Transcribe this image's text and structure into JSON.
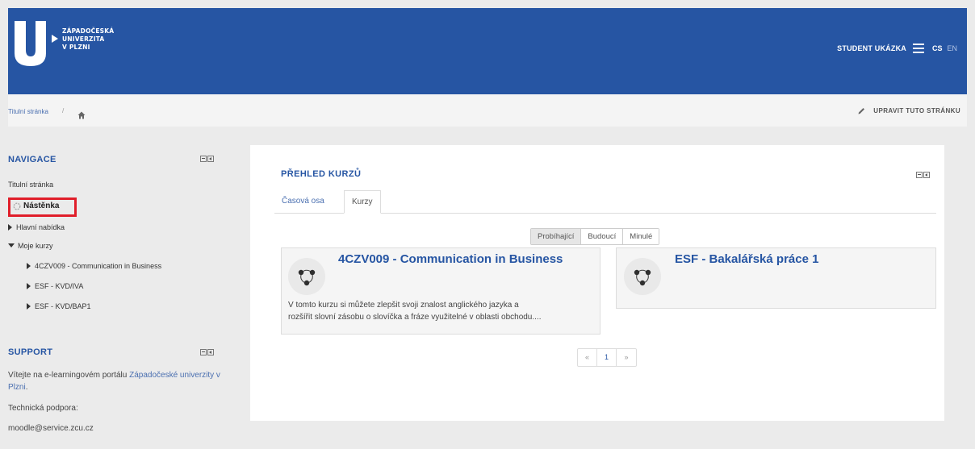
{
  "header": {
    "logo_lines": [
      "ZÁPADOČESKÁ",
      "UNIVERZITA",
      "V PLZNI"
    ],
    "user_name": "STUDENT UKÁZKA",
    "lang_active": "CS",
    "lang_other": "EN",
    "bg_color": "#2655a3"
  },
  "breadcrumb": {
    "home_link": "Titulní stránka",
    "separator": "/",
    "edit_page": "UPRAVIT TUTO STRÁNKU"
  },
  "navigation": {
    "title": "NAVIGACE",
    "items": {
      "titulni": "Titulní stránka",
      "nastenka": "Nástěnka",
      "hlavni": "Hlavní nabídka",
      "moje_kurzy": "Moje kurzy",
      "course1": "4CZV009 - Communication in Business",
      "course2": "ESF - KVD/IVA",
      "course3": "ESF - KVD/BAP1"
    }
  },
  "support": {
    "title": "SUPPORT",
    "intro_prefix": "Vítejte na e-learningovém portálu ",
    "intro_link_1": "Západočeské",
    "intro_link_2": "univerzity v Plzni",
    "intro_suffix": ".",
    "tech_label": "Technická podpora:",
    "email": "moodle@service.zcu.cz"
  },
  "course_overview": {
    "title": "PŘEHLED KURZŮ",
    "tabs": [
      "Časová osa",
      "Kurzy"
    ],
    "filters": [
      "Probíhající",
      "Budoucí",
      "Minulé"
    ],
    "courses": [
      {
        "name": "4CZV009 - Communication in Business",
        "summary_line1": "V tomto kurzu si můžete zlepšit svoji znalost anglického jazyka a",
        "summary_line2": "rozšířit slovní zásobu o slovíčka a fráze využitelné v oblasti obchodu...."
      },
      {
        "name": "ESF - Bakalářská práce 1"
      }
    ],
    "pager": [
      "«",
      "1",
      "»"
    ]
  }
}
